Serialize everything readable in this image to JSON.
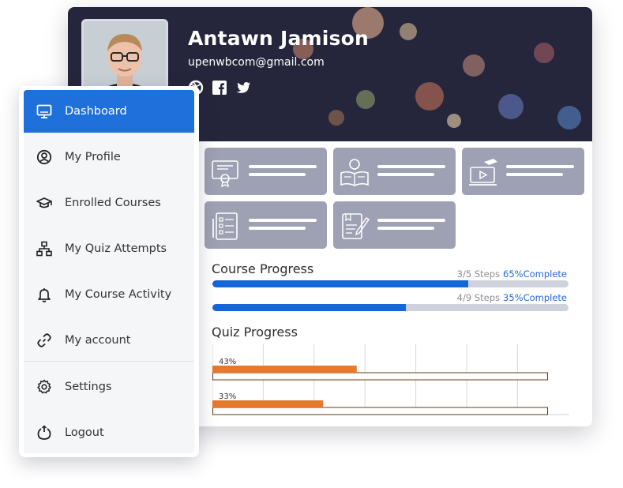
{
  "profile": {
    "name": "Antawn Jamison",
    "email": "upenwbcom@gmail.com",
    "social_icons": [
      "dribbble-icon",
      "facebook-icon",
      "twitter-icon"
    ]
  },
  "sidebar": {
    "items": [
      {
        "label": "Dashboard",
        "icon": "monitor-icon",
        "active": true
      },
      {
        "label": "My Profile",
        "icon": "user-circle-icon"
      },
      {
        "label": "Enrolled Courses",
        "icon": "graduation-cap-icon"
      },
      {
        "label": "My Quiz Attempts",
        "icon": "sitemap-icon"
      },
      {
        "label": "My Course Activity",
        "icon": "bell-icon"
      },
      {
        "label": "My account",
        "icon": "link-icon"
      },
      {
        "label": "Settings",
        "icon": "gear-icon"
      },
      {
        "label": "Logout",
        "icon": "power-icon"
      }
    ]
  },
  "tiles": [
    {
      "icon": "certificate-icon"
    },
    {
      "icon": "idea-book-icon"
    },
    {
      "icon": "video-course-icon"
    },
    {
      "icon": "checklist-icon"
    },
    {
      "icon": "assignment-icon"
    }
  ],
  "course_progress": {
    "title": "Course Progress",
    "items": [
      {
        "steps": "3/5 Steps",
        "complete": "65%Complete",
        "fill": 0.718
      },
      {
        "steps": "4/9 Steps",
        "complete": "35%Complete",
        "fill": 0.544
      }
    ]
  },
  "quiz_progress": {
    "title": "Quiz Progress",
    "chart_data": {
      "type": "bar",
      "orientation": "horizontal",
      "categories": [
        "",
        ""
      ],
      "values": [
        43,
        33
      ],
      "data_labels": [
        "43%",
        "33%"
      ],
      "xlim": [
        0,
        100
      ],
      "grid": true,
      "bar_color": "#e8782c"
    }
  },
  "colors": {
    "accent": "#1f70db",
    "progress": "#1466d9",
    "tile": "#9ea0b3",
    "banner": "#25263c"
  }
}
